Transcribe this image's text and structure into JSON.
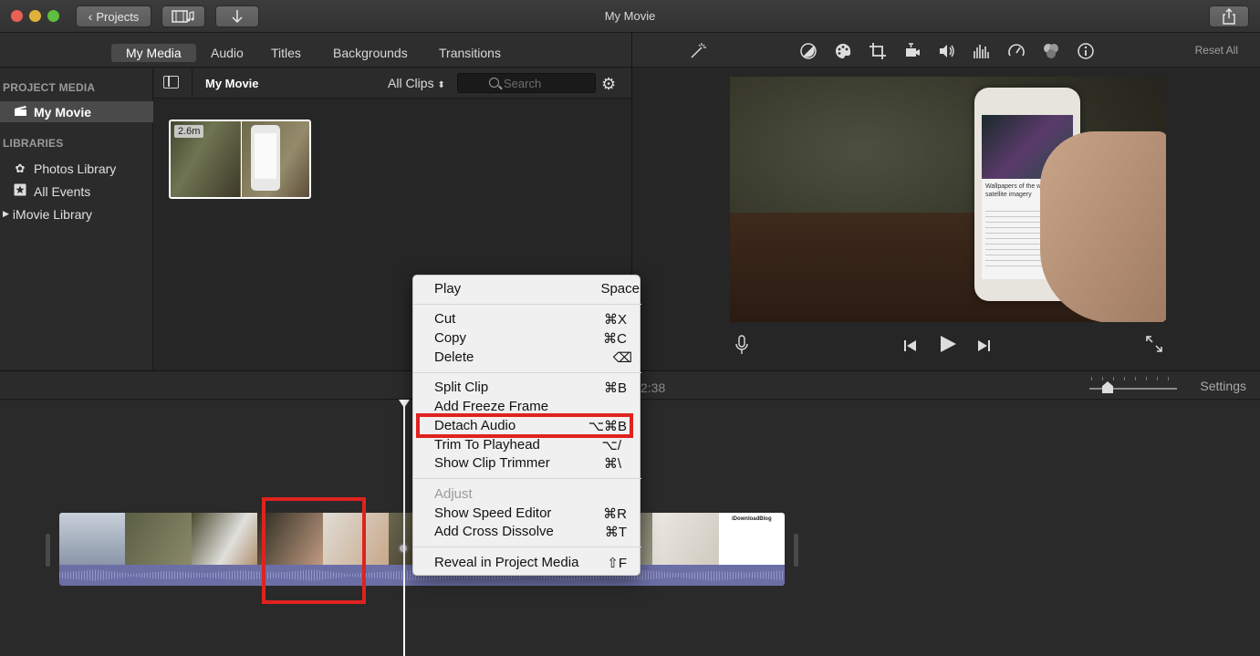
{
  "window": {
    "title": "My Movie"
  },
  "toolbar": {
    "projects_label": "Projects",
    "media_icon": "media-film-music-icon",
    "import_icon": "import-arrow-icon",
    "share_icon": "share-icon"
  },
  "tabs": [
    "My Media",
    "Audio",
    "Titles",
    "Backgrounds",
    "Transitions"
  ],
  "viewer_toolbar": {
    "reset_label": "Reset All",
    "icons": [
      "magic-wand-icon",
      "color-balance-icon",
      "color-palette-icon",
      "crop-icon",
      "stabilization-icon",
      "volume-icon",
      "equalizer-icon",
      "speed-icon",
      "filter-icon",
      "info-icon"
    ]
  },
  "sidebar": {
    "project_media_header": "PROJECT MEDIA",
    "project_item": "My Movie",
    "libraries_header": "LIBRARIES",
    "libraries": [
      "Photos Library",
      "All Events",
      "iMovie Library"
    ]
  },
  "browser": {
    "title": "My Movie",
    "filter": "All Clips",
    "search_placeholder": "Search",
    "clip_duration": "2.6m"
  },
  "preview": {
    "article_title": "Wallpapers of the week: satellite imagery"
  },
  "timeline": {
    "time_display": "2:38",
    "settings_label": "Settings",
    "end_frame_title": "iDownloadBlog"
  },
  "context_menu": {
    "items": [
      {
        "label": "Play",
        "shortcut": "Space"
      },
      {
        "label": "Cut",
        "shortcut": "⌘X"
      },
      {
        "label": "Copy",
        "shortcut": "⌘C"
      },
      {
        "label": "Delete",
        "shortcut": "⌫"
      },
      {
        "label": "Split Clip",
        "shortcut": "⌘B"
      },
      {
        "label": "Add Freeze Frame",
        "shortcut": ""
      },
      {
        "label": "Detach Audio",
        "shortcut": "⌥⌘B"
      },
      {
        "label": "Trim To Playhead",
        "shortcut": "⌥/"
      },
      {
        "label": "Show Clip Trimmer",
        "shortcut": "⌘\\"
      },
      {
        "label": "Adjust",
        "shortcut": ""
      },
      {
        "label": "Show Speed Editor",
        "shortcut": "⌘R"
      },
      {
        "label": "Add Cross Dissolve",
        "shortcut": "⌘T"
      },
      {
        "label": "Reveal in Project Media",
        "shortcut": "⇧F"
      }
    ]
  },
  "colors": {
    "highlight_red": "#e0221f",
    "audio_track": "#6c6fa6",
    "background": "#262626"
  }
}
